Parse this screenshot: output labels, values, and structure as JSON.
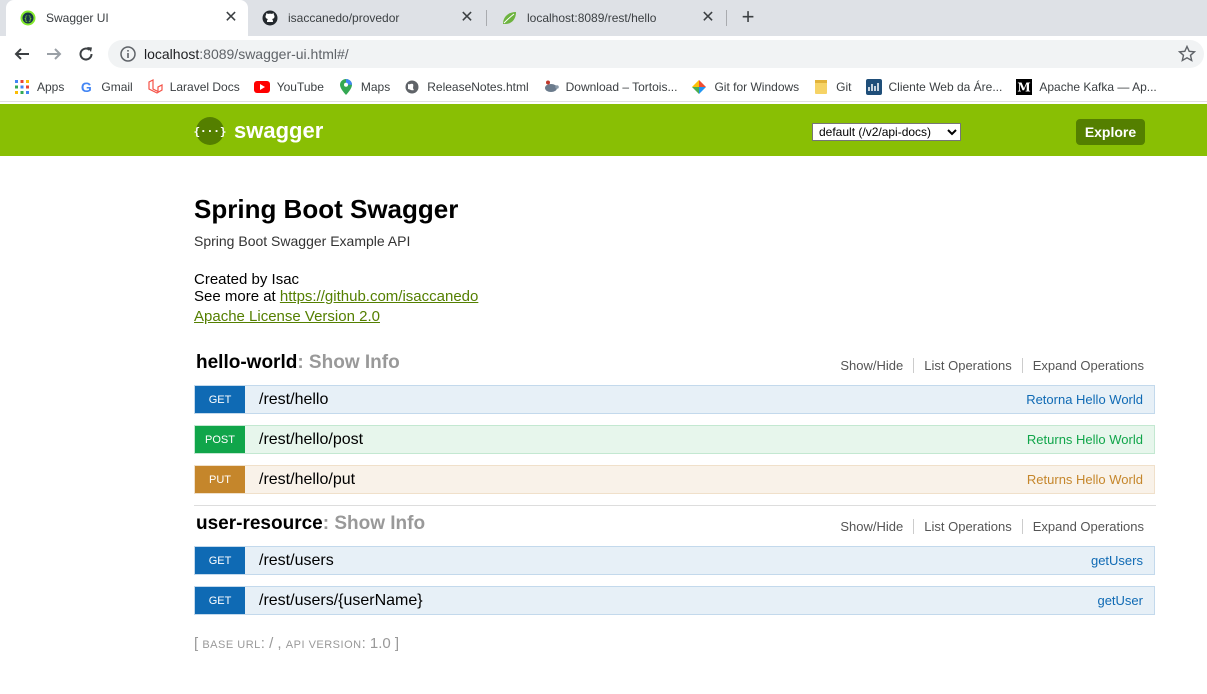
{
  "browser": {
    "tabs": [
      {
        "title": "Swagger UI",
        "icon": "swagger-icon",
        "active": true
      },
      {
        "title": "isaccanedo/provedor",
        "icon": "github-icon",
        "active": false
      },
      {
        "title": "localhost:8089/rest/hello",
        "icon": "spring-leaf-icon",
        "active": false
      }
    ],
    "new_tab": "+",
    "close_glyph": "✕",
    "url_host": "localhost",
    "url_rest": ":8089/swagger-ui.html#/",
    "bookmarks": [
      {
        "label": "Apps",
        "icon": "apps-grid-icon"
      },
      {
        "label": "Gmail",
        "icon": "google-icon"
      },
      {
        "label": "Laravel Docs",
        "icon": "laravel-icon"
      },
      {
        "label": "YouTube",
        "icon": "youtube-icon"
      },
      {
        "label": "Maps",
        "icon": "maps-pin-icon"
      },
      {
        "label": "ReleaseNotes.html",
        "icon": "globe-icon"
      },
      {
        "label": "Download – Tortois...",
        "icon": "tortoise-icon"
      },
      {
        "label": "Git for Windows",
        "icon": "git-windows-icon"
      },
      {
        "label": "Git",
        "icon": "folder-icon"
      },
      {
        "label": "Cliente Web da Áre...",
        "icon": "web-client-icon"
      },
      {
        "label": "Apache Kafka — Ap...",
        "icon": "medium-icon"
      }
    ]
  },
  "header": {
    "logo_glyph": "{···}",
    "brand": "swagger",
    "spec_select": "default (/v2/api-docs)",
    "explore_label": "Explore",
    "colors": {
      "bar": "#89bf04",
      "dark": "#547f00"
    }
  },
  "info": {
    "title": "Spring Boot Swagger",
    "description": "Spring Boot Swagger Example API",
    "created_by": "Created by Isac",
    "see_more_prefix": "See more at ",
    "see_more_link": "https://github.com/isaccanedo",
    "license": "Apache License Version 2.0"
  },
  "sections": [
    {
      "name": "hello-world",
      "show_info": ": Show Info",
      "links": [
        "Show/Hide",
        "List Operations",
        "Expand Operations"
      ],
      "operations": [
        {
          "method": "GET",
          "path": "/rest/hello",
          "summary": "Retorna Hello World"
        },
        {
          "method": "POST",
          "path": "/rest/hello/post",
          "summary": "Returns Hello World"
        },
        {
          "method": "PUT",
          "path": "/rest/hello/put",
          "summary": "Returns Hello World"
        }
      ]
    },
    {
      "name": "user-resource",
      "show_info": ": Show Info",
      "links": [
        "Show/Hide",
        "List Operations",
        "Expand Operations"
      ],
      "operations": [
        {
          "method": "GET",
          "path": "/rest/users",
          "summary": "getUsers"
        },
        {
          "method": "GET",
          "path": "/rest/users/{userName}",
          "summary": "getUser"
        }
      ]
    }
  ],
  "footer": {
    "open": "[ ",
    "base_url_label": "BASE URL",
    "base_url_value": ": / , ",
    "api_version_label": "API VERSION",
    "api_version_value": ": 1.0 ]"
  }
}
